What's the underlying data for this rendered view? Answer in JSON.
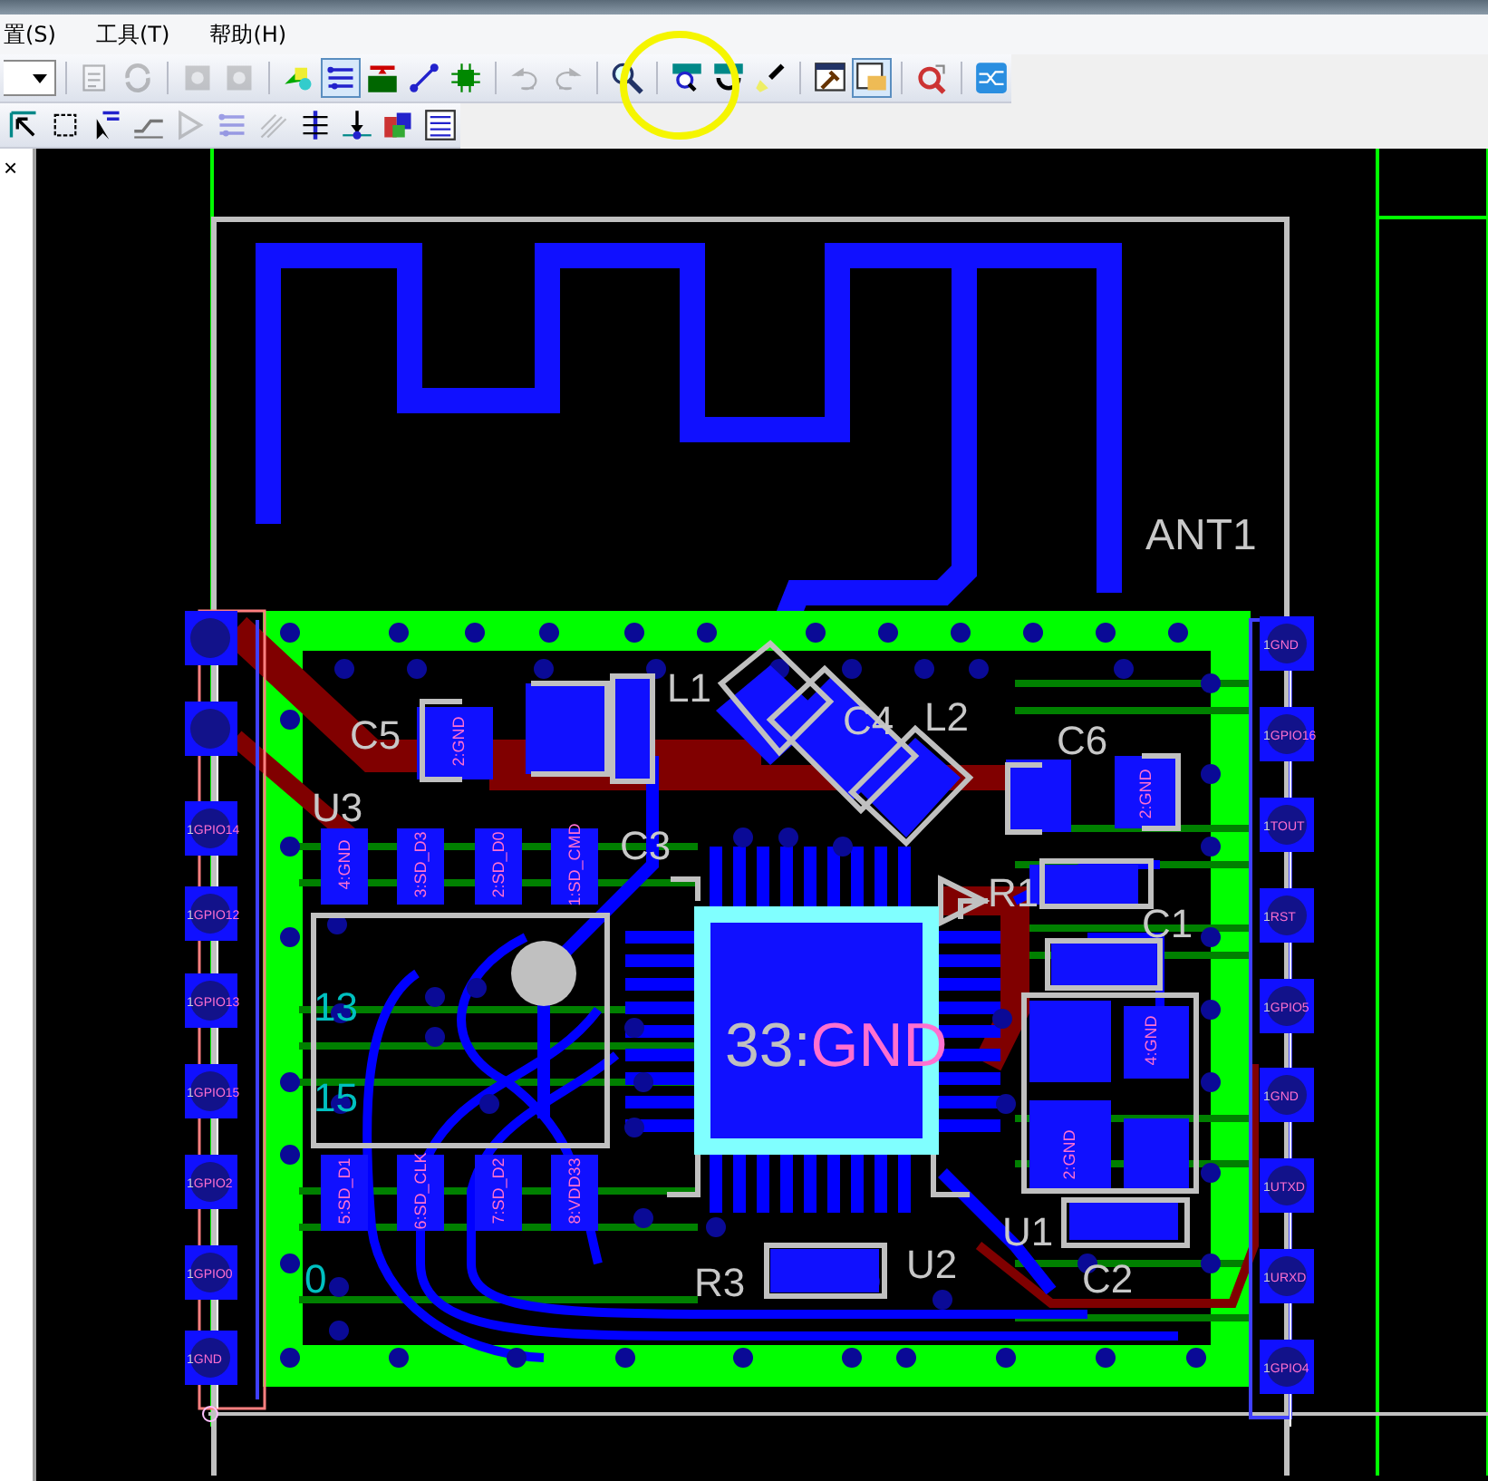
{
  "menu": [
    {
      "label": "置(S)"
    },
    {
      "label": "工具(T)"
    },
    {
      "label": "帮助(H)"
    }
  ],
  "toolbars": [
    {
      "combo": true,
      "groups": [
        [
          {
            "kind": "document",
            "disabled": true,
            "selected": false
          },
          {
            "kind": "refresh",
            "disabled": true,
            "selected": false
          }
        ],
        [
          {
            "kind": "gear",
            "disabled": true,
            "selected": false
          },
          {
            "kind": "gear",
            "disabled": true,
            "selected": false
          }
        ],
        [
          {
            "kind": "shapes",
            "disabled": false,
            "selected": false
          },
          {
            "kind": "traces",
            "disabled": false,
            "selected": true
          },
          {
            "kind": "board",
            "disabled": false,
            "selected": false
          },
          {
            "kind": "line",
            "disabled": false,
            "selected": false
          },
          {
            "kind": "chip",
            "disabled": false,
            "selected": false
          }
        ],
        [
          {
            "kind": "undo",
            "disabled": true,
            "selected": false
          },
          {
            "kind": "redo",
            "disabled": true,
            "selected": false
          }
        ],
        [
          {
            "kind": "search",
            "disabled": false,
            "selected": false
          }
        ],
        [
          {
            "kind": "magnifier",
            "disabled": false,
            "selected": false
          },
          {
            "kind": "rotate",
            "disabled": false,
            "selected": false
          },
          {
            "kind": "brush",
            "disabled": false,
            "selected": false
          }
        ],
        [
          {
            "kind": "hammer",
            "disabled": false,
            "selected": false
          },
          {
            "kind": "folder",
            "disabled": false,
            "selected": true
          }
        ],
        [
          {
            "kind": "zoom",
            "disabled": false,
            "selected": false
          }
        ],
        [
          {
            "kind": "wave",
            "disabled": false,
            "selected": false
          }
        ]
      ]
    },
    {
      "combo": false,
      "groups": [
        [
          {
            "kind": "cursor",
            "disabled": false,
            "selected": false
          },
          {
            "kind": "selection",
            "disabled": false,
            "selected": false
          },
          {
            "kind": "cursor-traces",
            "disabled": false,
            "selected": false
          },
          {
            "kind": "trace",
            "disabled": false,
            "selected": false
          },
          {
            "kind": "angle",
            "disabled": true,
            "selected": false
          },
          {
            "kind": "traces",
            "disabled": true,
            "selected": false
          },
          {
            "kind": "diagonal",
            "disabled": true,
            "selected": false
          },
          {
            "kind": "align",
            "disabled": false,
            "selected": false
          },
          {
            "kind": "pin",
            "disabled": false,
            "selected": false
          },
          {
            "kind": "layers",
            "disabled": false,
            "selected": false
          },
          {
            "kind": "list",
            "disabled": false,
            "selected": false
          }
        ]
      ]
    }
  ],
  "panel": {
    "close": "×"
  },
  "designators": [
    "ANT1",
    "C5",
    "U3",
    "L1",
    "C4",
    "L2",
    "C6",
    "C3",
    "R1",
    "C1",
    "R3",
    "U2",
    "U1",
    "C2"
  ],
  "net_numbers": [
    "13",
    "15",
    "0"
  ],
  "left_pins": [
    {
      "pin": "1",
      "net": "GPIO14"
    },
    {
      "pin": "1",
      "net": "GPIO12"
    },
    {
      "pin": "1",
      "net": "GPIO13"
    },
    {
      "pin": "1",
      "net": "GPIO15"
    },
    {
      "pin": "1",
      "net": "GPIO2"
    },
    {
      "pin": "1",
      "net": "GPIO0"
    },
    {
      "pin": "1",
      "net": "GND"
    }
  ],
  "right_pins": [
    {
      "pin": "1",
      "net": "GND"
    },
    {
      "pin": "1",
      "net": "GPIO16"
    },
    {
      "pin": "1",
      "net": "TOUT"
    },
    {
      "pin": "1",
      "net": "RST"
    },
    {
      "pin": "1",
      "net": "GPIO5"
    },
    {
      "pin": "1",
      "net": "GND"
    },
    {
      "pin": "1",
      "net": "UTXD"
    },
    {
      "pin": "1",
      "net": "URXD"
    },
    {
      "pin": "1",
      "net": "GPIO4"
    }
  ],
  "pad_labels": [
    "4:GND",
    "3:SD_D3",
    "2:SD_D0",
    "1:SD_CMD",
    "5:SD_D1",
    "6:SD_CLK",
    "7:SD_D2",
    "8:VDD33",
    "2:GND",
    "2:GND",
    "4:GND",
    "2:GND"
  ],
  "center_pad": {
    "pin": "33:",
    "net": "GND"
  }
}
